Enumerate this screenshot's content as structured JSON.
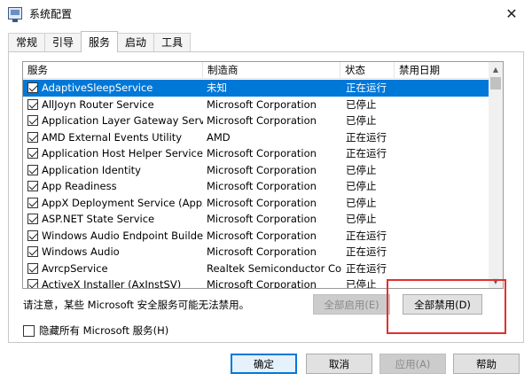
{
  "window": {
    "title": "系统配置",
    "icon": "msconfig-icon",
    "close_glyph": "✕"
  },
  "tabs": [
    {
      "label": "常规",
      "active": false
    },
    {
      "label": "引导",
      "active": false
    },
    {
      "label": "服务",
      "active": true
    },
    {
      "label": "启动",
      "active": false
    },
    {
      "label": "工具",
      "active": false
    }
  ],
  "services_table": {
    "columns": [
      "服务",
      "制造商",
      "状态",
      "禁用日期"
    ],
    "rows": [
      {
        "checked": true,
        "name": "AdaptiveSleepService",
        "manufacturer": "未知",
        "status": "正在运行",
        "disabled_date": "",
        "selected": true
      },
      {
        "checked": true,
        "name": "AllJoyn Router Service",
        "manufacturer": "Microsoft Corporation",
        "status": "已停止",
        "disabled_date": ""
      },
      {
        "checked": true,
        "name": "Application Layer Gateway Service",
        "manufacturer": "Microsoft Corporation",
        "status": "已停止",
        "disabled_date": ""
      },
      {
        "checked": true,
        "name": "AMD External Events Utility",
        "manufacturer": "AMD",
        "status": "正在运行",
        "disabled_date": ""
      },
      {
        "checked": true,
        "name": "Application Host Helper Service",
        "manufacturer": "Microsoft Corporation",
        "status": "正在运行",
        "disabled_date": ""
      },
      {
        "checked": true,
        "name": "Application Identity",
        "manufacturer": "Microsoft Corporation",
        "status": "已停止",
        "disabled_date": ""
      },
      {
        "checked": true,
        "name": "App Readiness",
        "manufacturer": "Microsoft Corporation",
        "status": "已停止",
        "disabled_date": ""
      },
      {
        "checked": true,
        "name": "AppX Deployment Service (AppX...",
        "manufacturer": "Microsoft Corporation",
        "status": "已停止",
        "disabled_date": ""
      },
      {
        "checked": true,
        "name": "ASP.NET State Service",
        "manufacturer": "Microsoft Corporation",
        "status": "已停止",
        "disabled_date": ""
      },
      {
        "checked": true,
        "name": "Windows Audio Endpoint Builder",
        "manufacturer": "Microsoft Corporation",
        "status": "正在运行",
        "disabled_date": ""
      },
      {
        "checked": true,
        "name": "Windows Audio",
        "manufacturer": "Microsoft Corporation",
        "status": "正在运行",
        "disabled_date": ""
      },
      {
        "checked": true,
        "name": "AvrcpService",
        "manufacturer": "Realtek Semiconductor Co...",
        "status": "正在运行",
        "disabled_date": ""
      },
      {
        "checked": true,
        "name": "ActiveX Installer (AxInstSV)",
        "manufacturer": "Microsoft Corporation",
        "status": "已停止",
        "disabled_date": ""
      }
    ]
  },
  "notice": "请注意，某些 Microsoft 安全服务可能无法禁用。",
  "buttons": {
    "enable_all": "全部启用(E)",
    "disable_all": "全部禁用(D)",
    "ok": "确定",
    "cancel": "取消",
    "apply": "应用(A)",
    "help": "帮助"
  },
  "hide_ms_checkbox": {
    "label": "隐藏所有 Microsoft 服务(H)",
    "checked": false
  },
  "colors": {
    "selection": "#0078d7",
    "annotation": "#e0302f"
  }
}
